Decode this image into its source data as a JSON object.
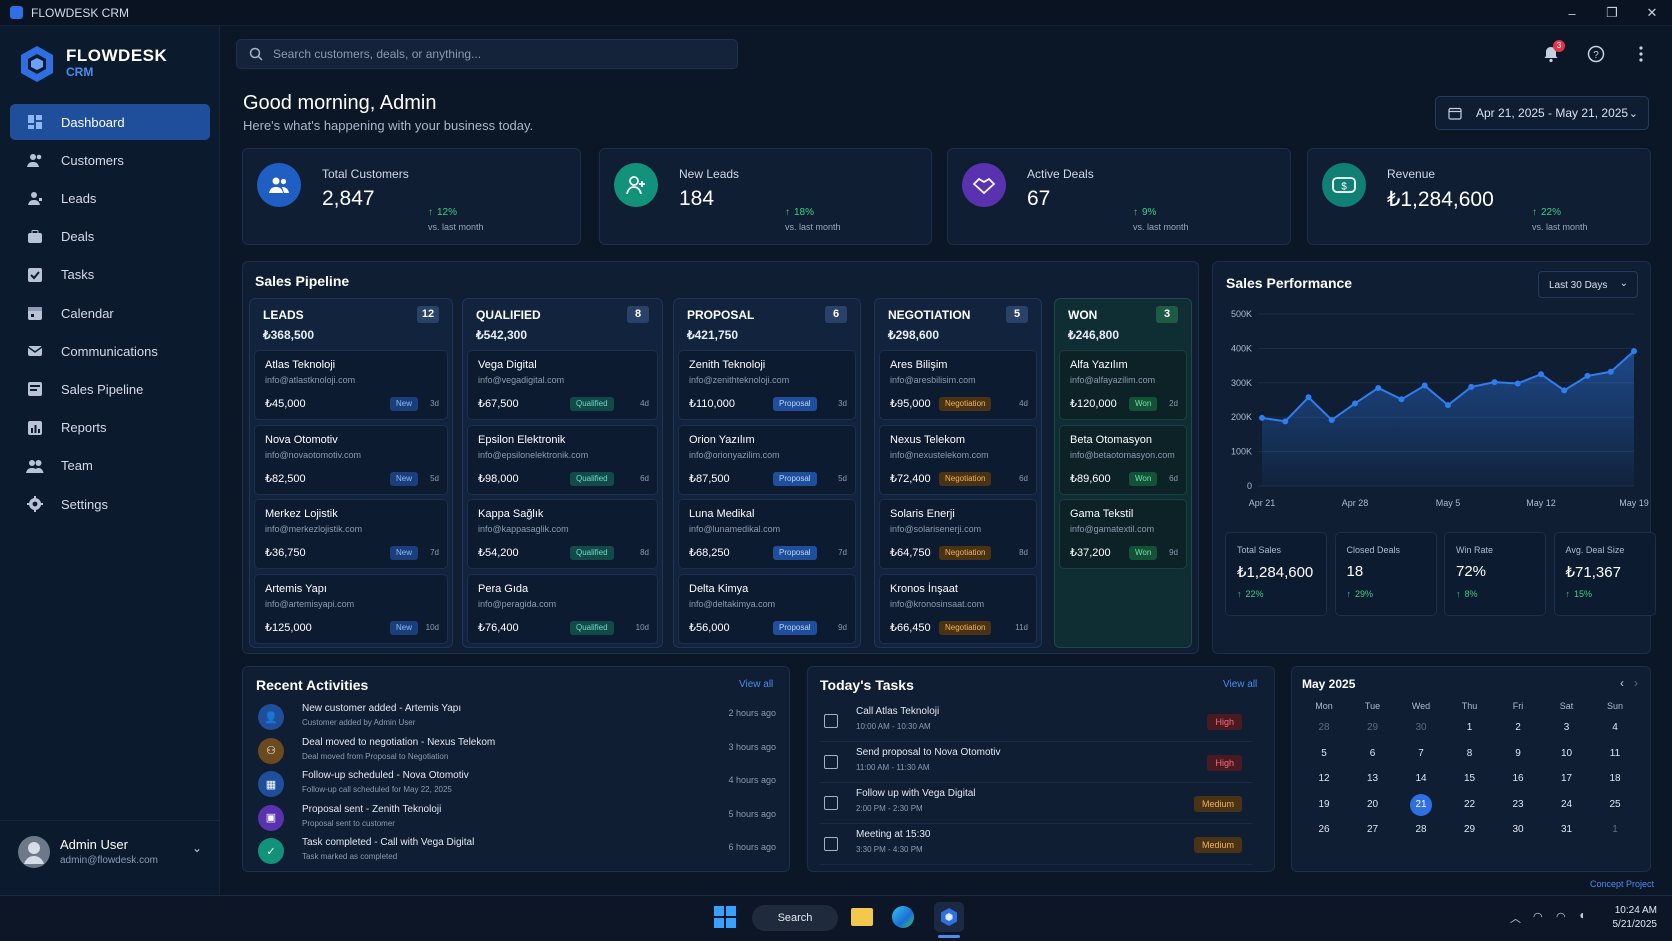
{
  "window": {
    "title": "FLOWDESK CRM"
  },
  "brand": {
    "name": "FLOWDESK",
    "sub": "CRM"
  },
  "nav": [
    {
      "label": "Dashboard",
      "icon": "dashboard-icon"
    },
    {
      "label": "Customers",
      "icon": "customers-icon"
    },
    {
      "label": "Leads",
      "icon": "leads-icon"
    },
    {
      "label": "Deals",
      "icon": "deals-icon"
    },
    {
      "label": "Tasks",
      "icon": "tasks-icon"
    },
    {
      "label": "Calendar",
      "icon": "calendar-icon"
    },
    {
      "label": "Communications",
      "icon": "communications-icon"
    },
    {
      "label": "Sales Pipeline",
      "icon": "pipeline-icon"
    },
    {
      "label": "Reports",
      "icon": "reports-icon"
    },
    {
      "label": "Team",
      "icon": "team-icon"
    },
    {
      "label": "Settings",
      "icon": "settings-icon"
    }
  ],
  "user": {
    "name": "Admin User",
    "email": "admin@flowdesk.com"
  },
  "search": {
    "placeholder": "Search customers, deals, or anything..."
  },
  "notifications": {
    "count": "3"
  },
  "greeting": {
    "title": "Good morning, Admin",
    "subtitle": "Here's what's happening with your business today."
  },
  "date_range": "Apr 21, 2025 - May 21, 2025",
  "stats": [
    {
      "label": "Total Customers",
      "value": "2,847",
      "change": "12%",
      "vs": "vs. last month",
      "color": "#1f5fc4"
    },
    {
      "label": "New Leads",
      "value": "184",
      "change": "18%",
      "vs": "vs. last month",
      "color": "#12927a"
    },
    {
      "label": "Active Deals",
      "value": "67",
      "change": "9%",
      "vs": "vs. last month",
      "color": "#5a32b0"
    },
    {
      "label": "Revenue",
      "value": "₺1,284,600",
      "change": "22%",
      "vs": "vs. last month",
      "color": "#0f8073"
    }
  ],
  "pipeline": {
    "title": "Sales Pipeline",
    "columns": [
      {
        "name": "LEADS",
        "count": "12",
        "total": "₺368,500",
        "deals": [
          {
            "name": "Atlas Teknoloji",
            "email": "info@atlastknoloji.com",
            "amount": "₺45,000",
            "status": "New",
            "age": "3d"
          },
          {
            "name": "Nova Otomotiv",
            "email": "info@novaotomotiv.com",
            "amount": "₺82,500",
            "status": "New",
            "age": "5d"
          },
          {
            "name": "Merkez Lojistik",
            "email": "info@merkezlojistik.com",
            "amount": "₺36,750",
            "status": "New",
            "age": "7d"
          },
          {
            "name": "Artemis Yapı",
            "email": "info@artemisyapi.com",
            "amount": "₺125,000",
            "status": "New",
            "age": "10d"
          }
        ]
      },
      {
        "name": "QUALIFIED",
        "count": "8",
        "total": "₺542,300",
        "deals": [
          {
            "name": "Vega Digital",
            "email": "info@vegadigital.com",
            "amount": "₺67,500",
            "status": "Qualified",
            "age": "4d"
          },
          {
            "name": "Epsilon Elektronik",
            "email": "info@epsilonelektronik.com",
            "amount": "₺98,000",
            "status": "Qualified",
            "age": "6d"
          },
          {
            "name": "Kappa Sağlık",
            "email": "info@kappasaglik.com",
            "amount": "₺54,200",
            "status": "Qualified",
            "age": "8d"
          },
          {
            "name": "Pera Gıda",
            "email": "info@peragida.com",
            "amount": "₺76,400",
            "status": "Qualified",
            "age": "10d"
          }
        ]
      },
      {
        "name": "PROPOSAL",
        "count": "6",
        "total": "₺421,750",
        "deals": [
          {
            "name": "Zenith Teknoloji",
            "email": "info@zenithteknoloji.com",
            "amount": "₺110,000",
            "status": "Proposal",
            "age": "3d"
          },
          {
            "name": "Orion Yazılım",
            "email": "info@orionyazilim.com",
            "amount": "₺87,500",
            "status": "Proposal",
            "age": "5d"
          },
          {
            "name": "Luna Medikal",
            "email": "info@lunamedikal.com",
            "amount": "₺68,250",
            "status": "Proposal",
            "age": "7d"
          },
          {
            "name": "Delta Kimya",
            "email": "info@deltakimya.com",
            "amount": "₺56,000",
            "status": "Proposal",
            "age": "9d"
          }
        ]
      },
      {
        "name": "NEGOTIATION",
        "count": "5",
        "total": "₺298,600",
        "deals": [
          {
            "name": "Ares Bilişim",
            "email": "info@aresbilisim.com",
            "amount": "₺95,000",
            "status": "Negotiation",
            "age": "4d"
          },
          {
            "name": "Nexus Telekom",
            "email": "info@nexustelekom.com",
            "amount": "₺72,400",
            "status": "Negotiation",
            "age": "6d"
          },
          {
            "name": "Solaris Enerji",
            "email": "info@solarisenerji.com",
            "amount": "₺64,750",
            "status": "Negotiation",
            "age": "8d"
          },
          {
            "name": "Kronos İnşaat",
            "email": "info@kronosinsaat.com",
            "amount": "₺66,450",
            "status": "Negotiation",
            "age": "11d"
          }
        ]
      },
      {
        "name": "WON",
        "count": "3",
        "total": "₺246,800",
        "deals": [
          {
            "name": "Alfa Yazılım",
            "email": "info@alfayazilim.com",
            "amount": "₺120,000",
            "status": "Won",
            "age": "2d"
          },
          {
            "name": "Beta Otomasyon",
            "email": "info@betaotomasyon.com",
            "amount": "₺89,600",
            "status": "Won",
            "age": "6d"
          },
          {
            "name": "Gama Tekstil",
            "email": "info@gamatextil.com",
            "amount": "₺37,200",
            "status": "Won",
            "age": "9d"
          }
        ]
      }
    ]
  },
  "performance": {
    "title": "Sales Performance",
    "range": "Last 30 Days",
    "stats": [
      {
        "label": "Total Sales",
        "value": "₺1,284,600",
        "change": "22%"
      },
      {
        "label": "Closed Deals",
        "value": "18",
        "change": "29%"
      },
      {
        "label": "Win Rate",
        "value": "72%",
        "change": "8%"
      },
      {
        "label": "Avg. Deal Size",
        "value": "₺71,367",
        "change": "15%"
      }
    ]
  },
  "chart_data": {
    "type": "area",
    "x_labels": [
      "Apr 21",
      "Apr 28",
      "May 5",
      "May 12",
      "May 19"
    ],
    "y_ticks": [
      "500K",
      "400K",
      "300K",
      "200K",
      "100K",
      "0"
    ],
    "ylim": [
      0,
      500000
    ],
    "values": [
      198000,
      188000,
      258000,
      192000,
      240000,
      285000,
      252000,
      292000,
      235000,
      288000,
      302000,
      298000,
      325000,
      278000,
      320000,
      332000,
      392000
    ],
    "color": "#2f7df0"
  },
  "activities": {
    "title": "Recent Activities",
    "view_all": "View all",
    "items": [
      {
        "title": "New customer added - Artemis Yapı",
        "sub": "Customer added by Admin User",
        "time": "2 hours ago",
        "color": "#1f4f9b",
        "icon": "user-icon"
      },
      {
        "title": "Deal moved to negotiation - Nexus Telekom",
        "sub": "Deal moved from Proposal to Negotiation",
        "time": "3 hours ago",
        "color": "#6b4a1f",
        "icon": "handshake-icon"
      },
      {
        "title": "Follow-up scheduled - Nova Otomotiv",
        "sub": "Follow-up call scheduled for May 22, 2025",
        "time": "4 hours ago",
        "color": "#1f4f9b",
        "icon": "calendar-icon"
      },
      {
        "title": "Proposal sent - Zenith Teknoloji",
        "sub": "Proposal sent to customer",
        "time": "5 hours ago",
        "color": "#5a32b0",
        "icon": "document-icon"
      },
      {
        "title": "Task completed - Call with Vega Digital",
        "sub": "Task marked as completed",
        "time": "6 hours ago",
        "color": "#12927a",
        "icon": "check-icon"
      }
    ]
  },
  "tasks": {
    "title": "Today's Tasks",
    "view_all": "View all",
    "items": [
      {
        "title": "Call Atlas Teknoloji",
        "time": "10:00 AM - 10:30 AM",
        "priority": "High"
      },
      {
        "title": "Send proposal to Nova Otomotiv",
        "time": "11:00 AM - 11:30 AM",
        "priority": "High"
      },
      {
        "title": "Follow up with Vega Digital",
        "time": "2:00 PM - 2:30 PM",
        "priority": "Medium"
      },
      {
        "title": "Meeting at 15:30",
        "time": "3:30 PM - 4:30 PM",
        "priority": "Medium"
      }
    ]
  },
  "calendar": {
    "month": "May 2025",
    "weekdays": [
      "Mon",
      "Tue",
      "Wed",
      "Thu",
      "Fri",
      "Sat",
      "Sun"
    ],
    "weeks": [
      [
        "28",
        "29",
        "30",
        "1",
        "2",
        "3",
        "4"
      ],
      [
        "5",
        "6",
        "7",
        "8",
        "9",
        "10",
        "11"
      ],
      [
        "12",
        "13",
        "14",
        "15",
        "16",
        "17",
        "18"
      ],
      [
        "19",
        "20",
        "21",
        "22",
        "23",
        "24",
        "25"
      ],
      [
        "26",
        "27",
        "28",
        "29",
        "30",
        "31",
        "1"
      ]
    ],
    "today": "21"
  },
  "footer_note": "Concept Project",
  "taskbar": {
    "search": "Search",
    "time": "10:24 AM",
    "date": "5/21/2025"
  }
}
